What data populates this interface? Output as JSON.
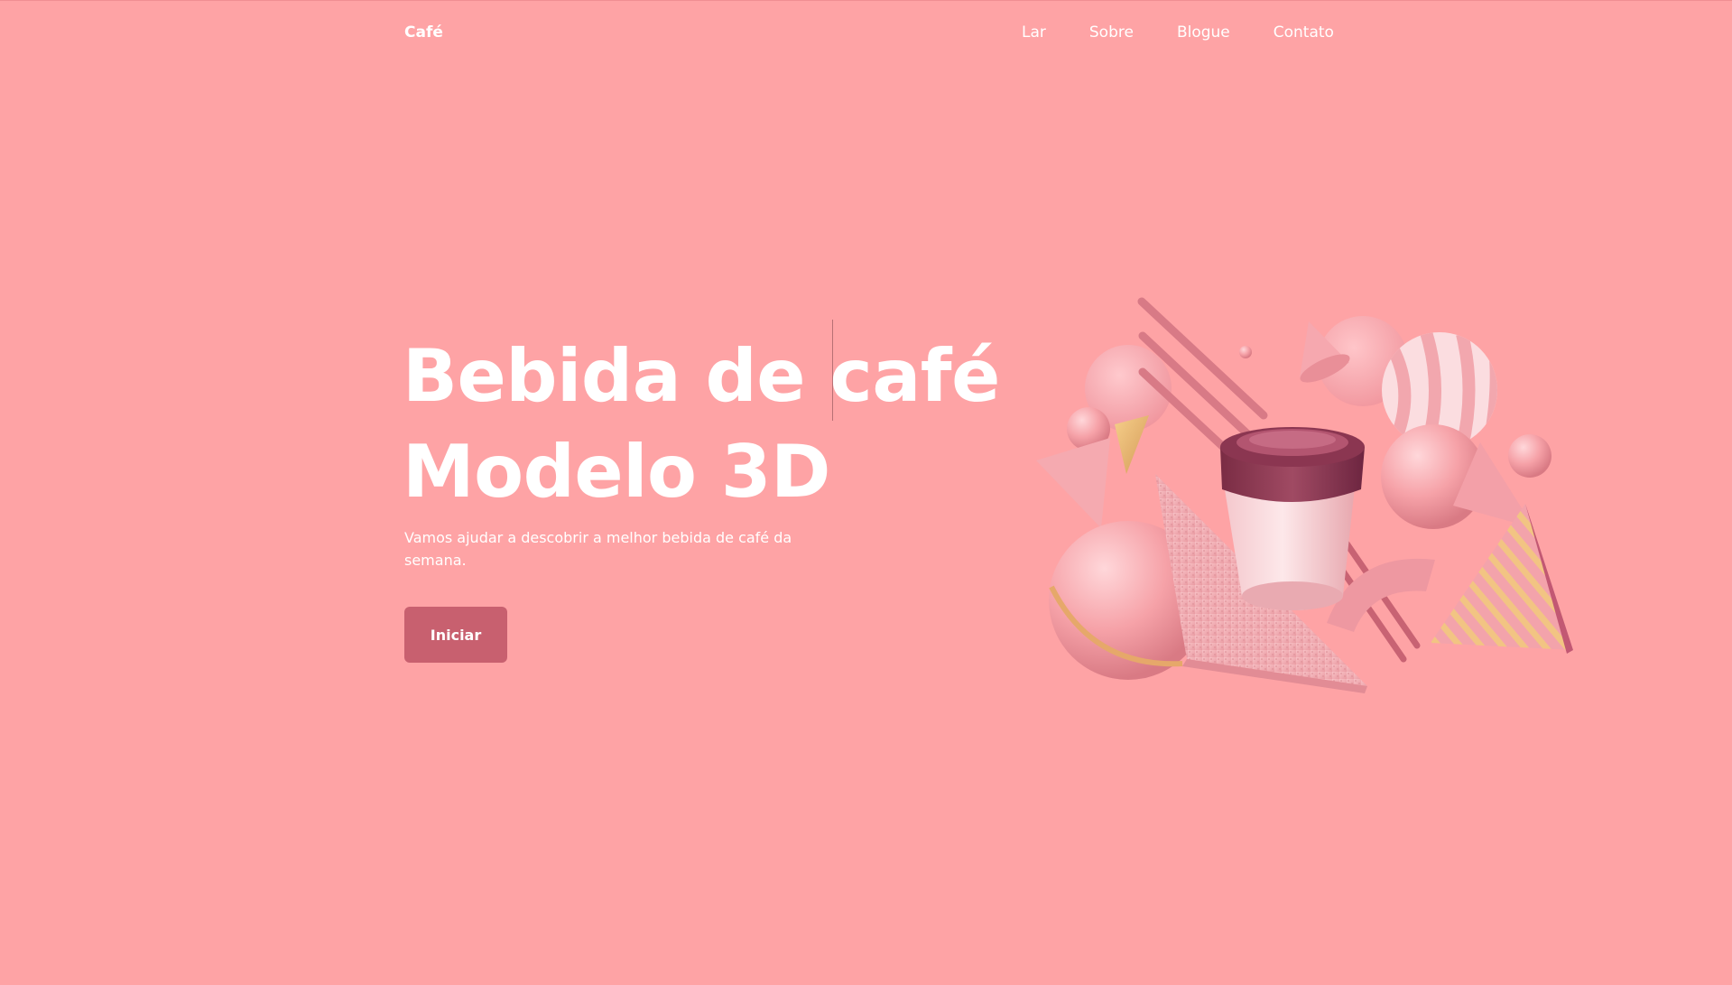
{
  "header": {
    "brand": "Café",
    "nav": [
      {
        "label": "Lar"
      },
      {
        "label": "Sobre"
      },
      {
        "label": "Blogue"
      },
      {
        "label": "Contato"
      }
    ]
  },
  "hero": {
    "title_line1": "Bebida de café",
    "title_line2": "Modelo 3D",
    "subtitle": "Vamos ajudar a descobrir a melhor bebida de café da semana.",
    "cta_label": "Iniciar"
  },
  "colors": {
    "background": "#fea3a5",
    "button": "#c8606f",
    "text": "#ffffff"
  },
  "illustration": {
    "icon": "coffee-cup-3d-icon"
  }
}
